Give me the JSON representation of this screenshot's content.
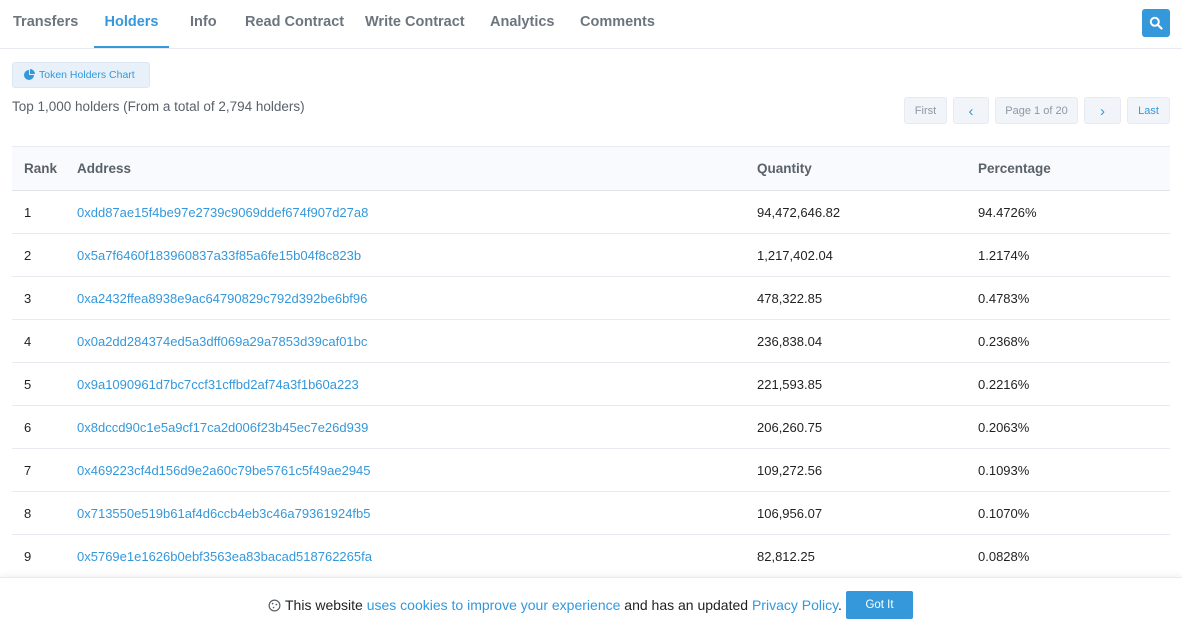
{
  "tabs": [
    {
      "label": "Transfers"
    },
    {
      "label": "Holders"
    },
    {
      "label": "Info"
    },
    {
      "label": "Read Contract"
    },
    {
      "label": "Write Contract"
    },
    {
      "label": "Analytics"
    },
    {
      "label": "Comments"
    }
  ],
  "active_tab": "Holders",
  "chart_button": {
    "label": "Token Holders Chart"
  },
  "summary": "Top 1,000 holders (From a total of 2,794 holders)",
  "pagination": {
    "first": "First",
    "prev": "‹",
    "page": "Page 1 of 20",
    "next": "›",
    "last": "Last"
  },
  "table": {
    "headers": {
      "rank": "Rank",
      "address": "Address",
      "quantity": "Quantity",
      "percentage": "Percentage"
    },
    "rows": [
      {
        "rank": "1",
        "address": "0xdd87ae15f4be97e2739c9069ddef674f907d27a8",
        "quantity": "94,472,646.82",
        "percentage": "94.4726%"
      },
      {
        "rank": "2",
        "address": "0x5a7f6460f183960837a33f85a6fe15b04f8c823b",
        "quantity": "1,217,402.04",
        "percentage": "1.2174%"
      },
      {
        "rank": "3",
        "address": "0xa2432ffea8938e9ac64790829c792d392be6bf96",
        "quantity": "478,322.85",
        "percentage": "0.4783%"
      },
      {
        "rank": "4",
        "address": "0x0a2dd284374ed5a3dff069a29a7853d39caf01bc",
        "quantity": "236,838.04",
        "percentage": "0.2368%"
      },
      {
        "rank": "5",
        "address": "0x9a1090961d7bc7ccf31cffbd2af74a3f1b60a223",
        "quantity": "221,593.85",
        "percentage": "0.2216%"
      },
      {
        "rank": "6",
        "address": "0x8dccd90c1e5a9cf17ca2d006f23b45ec7e26d939",
        "quantity": "206,260.75",
        "percentage": "0.2063%"
      },
      {
        "rank": "7",
        "address": "0x469223cf4d156d9e2a60c79be5761c5f49ae2945",
        "quantity": "109,272.56",
        "percentage": "0.1093%"
      },
      {
        "rank": "8",
        "address": "0x713550e519b61af4d6ccb4eb3c46a79361924fb5",
        "quantity": "106,956.07",
        "percentage": "0.1070%"
      },
      {
        "rank": "9",
        "address": "0x5769e1e1626b0ebf3563ea83bacad518762265fa",
        "quantity": "82,812.25",
        "percentage": "0.0828%"
      }
    ]
  },
  "cookie": {
    "text_before": "This website",
    "link1": "uses cookies to improve your experience",
    "text_middle": "and has an updated",
    "link2": "Privacy Policy",
    "text_end": ".",
    "button": "Got It"
  },
  "colors": {
    "accent": "#3498db",
    "muted": "#6c757e"
  },
  "icons": {
    "search": "search-icon",
    "chart": "pie-chart-icon",
    "cookie": "cookie-icon"
  }
}
